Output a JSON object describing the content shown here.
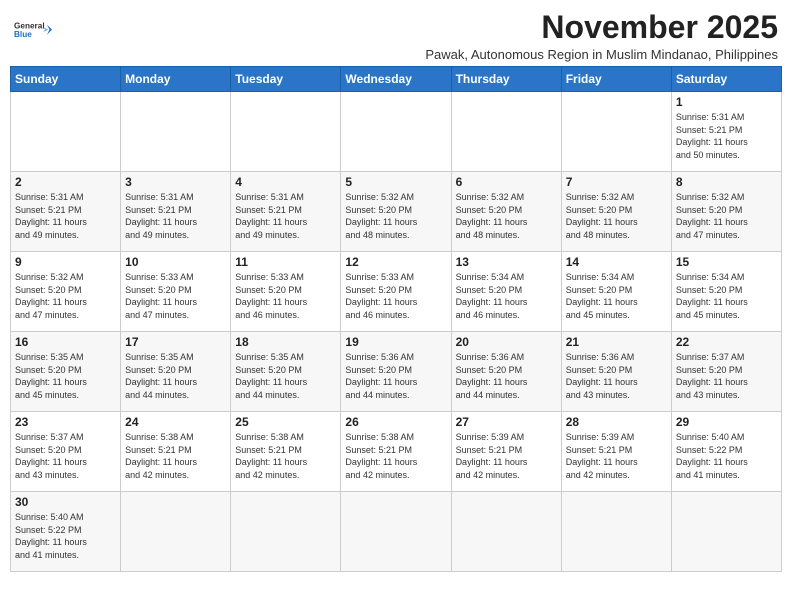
{
  "header": {
    "logo_line1": "General",
    "logo_line2": "Blue",
    "month_title": "November 2025",
    "subtitle": "Pawak, Autonomous Region in Muslim Mindanao, Philippines"
  },
  "days_of_week": [
    "Sunday",
    "Monday",
    "Tuesday",
    "Wednesday",
    "Thursday",
    "Friday",
    "Saturday"
  ],
  "weeks": [
    [
      {
        "day": "",
        "info": ""
      },
      {
        "day": "",
        "info": ""
      },
      {
        "day": "",
        "info": ""
      },
      {
        "day": "",
        "info": ""
      },
      {
        "day": "",
        "info": ""
      },
      {
        "day": "",
        "info": ""
      },
      {
        "day": "1",
        "info": "Sunrise: 5:31 AM\nSunset: 5:21 PM\nDaylight: 11 hours\nand 50 minutes."
      }
    ],
    [
      {
        "day": "2",
        "info": "Sunrise: 5:31 AM\nSunset: 5:21 PM\nDaylight: 11 hours\nand 49 minutes."
      },
      {
        "day": "3",
        "info": "Sunrise: 5:31 AM\nSunset: 5:21 PM\nDaylight: 11 hours\nand 49 minutes."
      },
      {
        "day": "4",
        "info": "Sunrise: 5:31 AM\nSunset: 5:21 PM\nDaylight: 11 hours\nand 49 minutes."
      },
      {
        "day": "5",
        "info": "Sunrise: 5:32 AM\nSunset: 5:20 PM\nDaylight: 11 hours\nand 48 minutes."
      },
      {
        "day": "6",
        "info": "Sunrise: 5:32 AM\nSunset: 5:20 PM\nDaylight: 11 hours\nand 48 minutes."
      },
      {
        "day": "7",
        "info": "Sunrise: 5:32 AM\nSunset: 5:20 PM\nDaylight: 11 hours\nand 48 minutes."
      },
      {
        "day": "8",
        "info": "Sunrise: 5:32 AM\nSunset: 5:20 PM\nDaylight: 11 hours\nand 47 minutes."
      }
    ],
    [
      {
        "day": "9",
        "info": "Sunrise: 5:32 AM\nSunset: 5:20 PM\nDaylight: 11 hours\nand 47 minutes."
      },
      {
        "day": "10",
        "info": "Sunrise: 5:33 AM\nSunset: 5:20 PM\nDaylight: 11 hours\nand 47 minutes."
      },
      {
        "day": "11",
        "info": "Sunrise: 5:33 AM\nSunset: 5:20 PM\nDaylight: 11 hours\nand 46 minutes."
      },
      {
        "day": "12",
        "info": "Sunrise: 5:33 AM\nSunset: 5:20 PM\nDaylight: 11 hours\nand 46 minutes."
      },
      {
        "day": "13",
        "info": "Sunrise: 5:34 AM\nSunset: 5:20 PM\nDaylight: 11 hours\nand 46 minutes."
      },
      {
        "day": "14",
        "info": "Sunrise: 5:34 AM\nSunset: 5:20 PM\nDaylight: 11 hours\nand 45 minutes."
      },
      {
        "day": "15",
        "info": "Sunrise: 5:34 AM\nSunset: 5:20 PM\nDaylight: 11 hours\nand 45 minutes."
      }
    ],
    [
      {
        "day": "16",
        "info": "Sunrise: 5:35 AM\nSunset: 5:20 PM\nDaylight: 11 hours\nand 45 minutes."
      },
      {
        "day": "17",
        "info": "Sunrise: 5:35 AM\nSunset: 5:20 PM\nDaylight: 11 hours\nand 44 minutes."
      },
      {
        "day": "18",
        "info": "Sunrise: 5:35 AM\nSunset: 5:20 PM\nDaylight: 11 hours\nand 44 minutes."
      },
      {
        "day": "19",
        "info": "Sunrise: 5:36 AM\nSunset: 5:20 PM\nDaylight: 11 hours\nand 44 minutes."
      },
      {
        "day": "20",
        "info": "Sunrise: 5:36 AM\nSunset: 5:20 PM\nDaylight: 11 hours\nand 44 minutes."
      },
      {
        "day": "21",
        "info": "Sunrise: 5:36 AM\nSunset: 5:20 PM\nDaylight: 11 hours\nand 43 minutes."
      },
      {
        "day": "22",
        "info": "Sunrise: 5:37 AM\nSunset: 5:20 PM\nDaylight: 11 hours\nand 43 minutes."
      }
    ],
    [
      {
        "day": "23",
        "info": "Sunrise: 5:37 AM\nSunset: 5:20 PM\nDaylight: 11 hours\nand 43 minutes."
      },
      {
        "day": "24",
        "info": "Sunrise: 5:38 AM\nSunset: 5:21 PM\nDaylight: 11 hours\nand 42 minutes."
      },
      {
        "day": "25",
        "info": "Sunrise: 5:38 AM\nSunset: 5:21 PM\nDaylight: 11 hours\nand 42 minutes."
      },
      {
        "day": "26",
        "info": "Sunrise: 5:38 AM\nSunset: 5:21 PM\nDaylight: 11 hours\nand 42 minutes."
      },
      {
        "day": "27",
        "info": "Sunrise: 5:39 AM\nSunset: 5:21 PM\nDaylight: 11 hours\nand 42 minutes."
      },
      {
        "day": "28",
        "info": "Sunrise: 5:39 AM\nSunset: 5:21 PM\nDaylight: 11 hours\nand 42 minutes."
      },
      {
        "day": "29",
        "info": "Sunrise: 5:40 AM\nSunset: 5:22 PM\nDaylight: 11 hours\nand 41 minutes."
      }
    ],
    [
      {
        "day": "30",
        "info": "Sunrise: 5:40 AM\nSunset: 5:22 PM\nDaylight: 11 hours\nand 41 minutes."
      },
      {
        "day": "",
        "info": ""
      },
      {
        "day": "",
        "info": ""
      },
      {
        "day": "",
        "info": ""
      },
      {
        "day": "",
        "info": ""
      },
      {
        "day": "",
        "info": ""
      },
      {
        "day": "",
        "info": ""
      }
    ]
  ]
}
